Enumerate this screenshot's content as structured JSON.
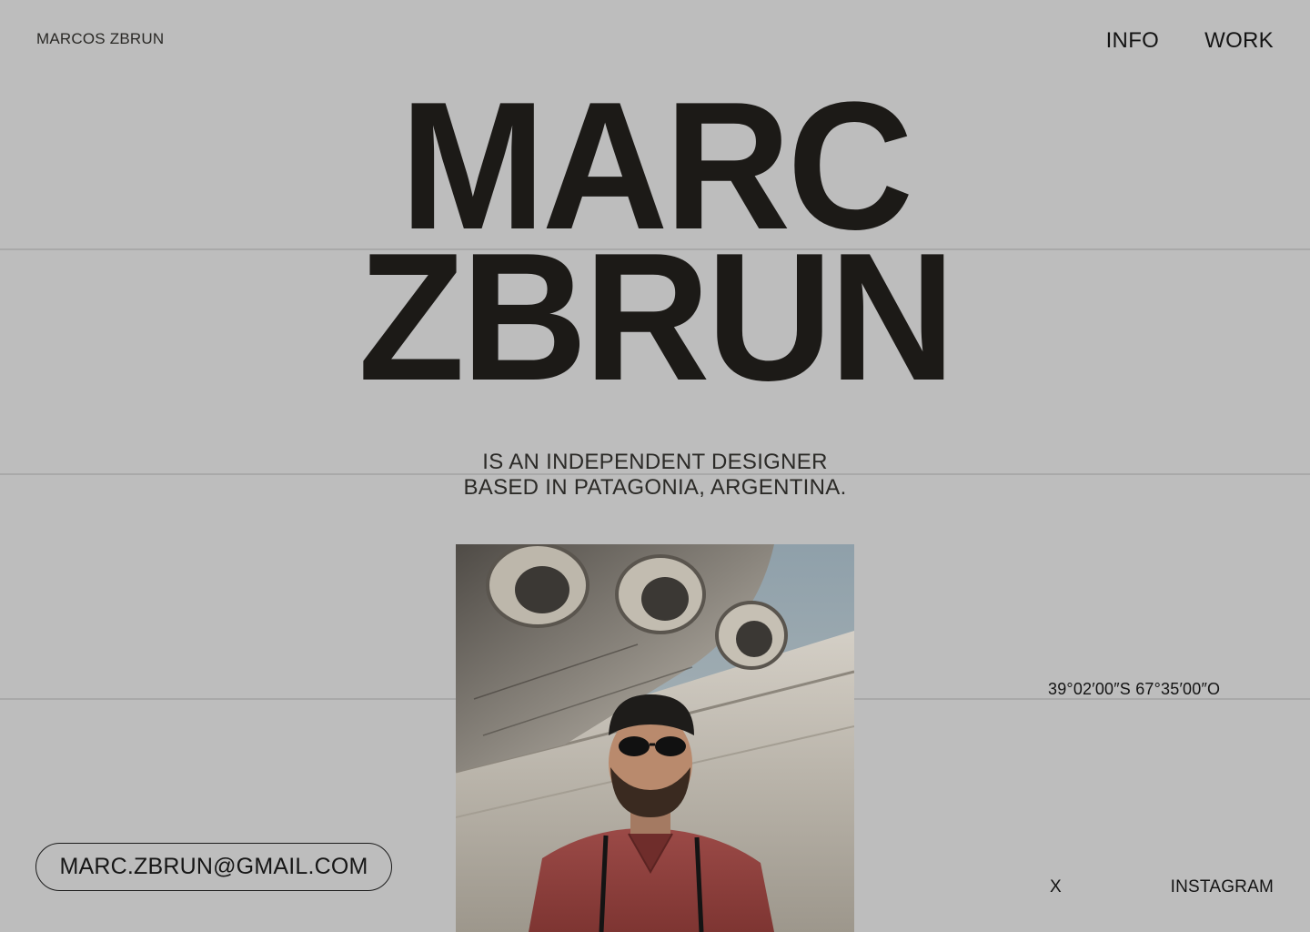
{
  "header": {
    "brand": "MARCOS ZBRUN",
    "nav": [
      {
        "label": "INFO"
      },
      {
        "label": "WORK"
      }
    ]
  },
  "hero": {
    "line1": "MARC",
    "line2": "ZBRUN"
  },
  "subtitle": {
    "line1": "IS AN INDEPENDENT DESIGNER",
    "line2": "BASED IN PATAGONIA, ARGENTINA."
  },
  "photo": {
    "alt_subject": "portrait-photo"
  },
  "location": {
    "coordinates": "39°02′00″S 67°35′00″O"
  },
  "contact": {
    "email": "MARC.ZBRUN@GMAIL.COM"
  },
  "social": {
    "x_label": "X",
    "instagram_label": "INSTAGRAM"
  },
  "colors": {
    "background": "#bdbdbd",
    "text": "#1a1917",
    "rule": "#a9a9a9"
  }
}
